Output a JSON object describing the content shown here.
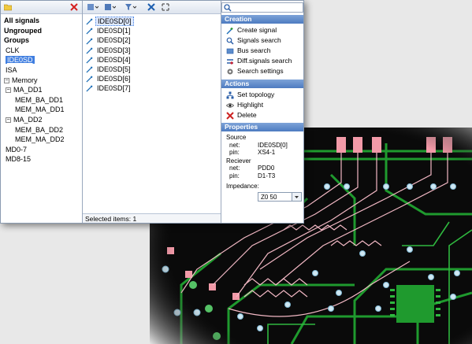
{
  "left_panel": {
    "tree": [
      {
        "label": "All signals",
        "level": 0,
        "bold": true
      },
      {
        "label": "Ungrouped",
        "level": 0,
        "bold": true
      },
      {
        "label": "Groups",
        "level": 0,
        "bold": true
      },
      {
        "label": "CLK",
        "level": 1
      },
      {
        "label": "IDE0SD",
        "level": 1,
        "selected": true
      },
      {
        "label": "ISA",
        "level": 1
      },
      {
        "label": "Memory",
        "level": 0,
        "expander": "minus"
      },
      {
        "label": "MA_DD1",
        "level": 1,
        "expander": "minus"
      },
      {
        "label": "MEM_BA_DD1",
        "level": 2
      },
      {
        "label": "MEM_MA_DD1",
        "level": 2
      },
      {
        "label": "MA_DD2",
        "level": 1,
        "expander": "minus"
      },
      {
        "label": "MEM_BA_DD2",
        "level": 2
      },
      {
        "label": "MEM_MA_DD2",
        "level": 2
      },
      {
        "label": "MD0-7",
        "level": 1
      },
      {
        "label": "MD8-15",
        "level": 1
      }
    ]
  },
  "signals": [
    "IDE0SD[0]",
    "IDE0SD[1]",
    "IDE0SD[2]",
    "IDE0SD[3]",
    "IDE0SD[4]",
    "IDE0SD[5]",
    "IDE0SD[6]",
    "IDE0SD[7]"
  ],
  "status_bar": {
    "text": "Selected items: 1"
  },
  "right_panel": {
    "creation_title": "Creation",
    "creation_actions": [
      {
        "label": "Create signal",
        "icon": "create-signal-icon"
      },
      {
        "label": "Signals search",
        "icon": "signals-search-icon"
      },
      {
        "label": "Bus search",
        "icon": "bus-search-icon"
      },
      {
        "label": "Diff.signals search",
        "icon": "diff-signals-icon"
      },
      {
        "label": "Search settings",
        "icon": "gear-icon"
      }
    ],
    "actions_title": "Actions",
    "actions": [
      {
        "label": "Set topology",
        "icon": "topology-icon"
      },
      {
        "label": "Highlight",
        "icon": "eye-icon"
      },
      {
        "label": "Delete",
        "icon": "delete-icon"
      }
    ],
    "properties_title": "Properties",
    "source_label": "Source",
    "source_net_key": "net:",
    "source_net": "IDE0SD[0]",
    "source_pin_key": "pin:",
    "source_pin": "XS4-1",
    "receiver_label": "Reciever",
    "receiver_net_key": "net:",
    "receiver_net": "PDD0",
    "receiver_pin_key": "pin:",
    "receiver_pin": "D1-T3",
    "impedance_label": "Impedance:",
    "impedance_value": "Z0 50"
  },
  "colors": {
    "accent": "#3f7ee0",
    "section_header": "#4d7bc0",
    "pcb_bg": "#0a0a0a",
    "trace_green": "#1f9a2e",
    "trace_pink": "#f2b8c4",
    "pad_pink": "#f29aa8"
  }
}
